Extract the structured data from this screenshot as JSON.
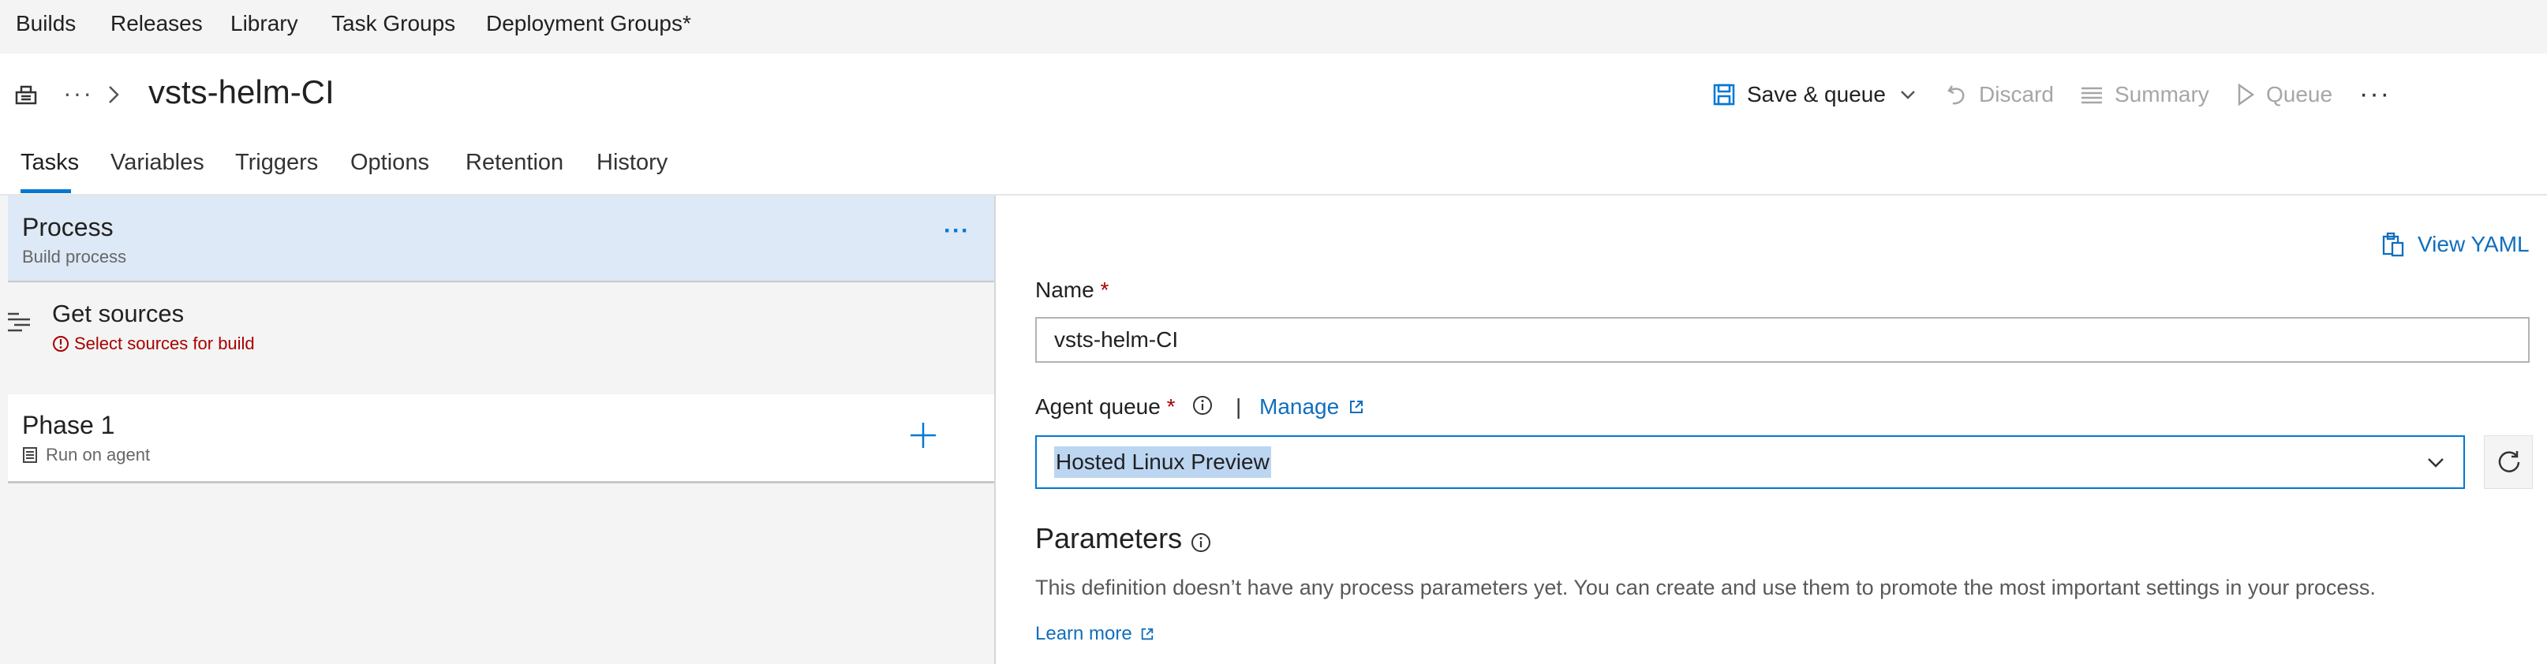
{
  "topnav": {
    "items": [
      "Builds",
      "Releases",
      "Library",
      "Task Groups",
      "Deployment Groups*"
    ]
  },
  "header": {
    "breadcrumb_more": "···",
    "title": "vsts-helm-CI"
  },
  "toolbar": {
    "save_queue": "Save & queue",
    "discard": "Discard",
    "summary": "Summary",
    "queue": "Queue",
    "more": "···"
  },
  "tabs": [
    "Tasks",
    "Variables",
    "Triggers",
    "Options",
    "Retention",
    "History"
  ],
  "left_pane": {
    "process": {
      "title": "Process",
      "subtitle": "Build process",
      "more": "···"
    },
    "get_sources": {
      "title": "Get sources",
      "warning": "Select sources for build"
    },
    "phase": {
      "title": "Phase 1",
      "subtitle": "Run on agent"
    }
  },
  "right_pane": {
    "view_yaml": "View YAML",
    "name_label": "Name",
    "required_marker": "*",
    "name_value": "vsts-helm-CI",
    "agent_queue_label": "Agent queue",
    "pipe": "|",
    "manage_link": "Manage",
    "agent_queue_value": "Hosted Linux Preview",
    "parameters_title": "Parameters",
    "parameters_desc": "This definition doesn’t have any process parameters yet. You can create and use them to promote the most important settings in your process.",
    "learn_more": "Learn more"
  },
  "colors": {
    "accent": "#0078d4",
    "link": "#106ebe",
    "error": "#a80000",
    "selected_row": "#dde9f6",
    "selection_highlight": "#bcd6f2",
    "pane_bg": "#f4f4f4"
  },
  "icons": [
    "build-pipeline-icon",
    "chevron-right-icon",
    "save-icon",
    "chevron-down-icon",
    "undo-icon",
    "list-icon",
    "play-icon",
    "source-tree-icon",
    "warning-circle-icon",
    "agent-icon",
    "plus-icon",
    "clipboard-icon",
    "info-icon",
    "external-link-icon",
    "refresh-icon"
  ]
}
